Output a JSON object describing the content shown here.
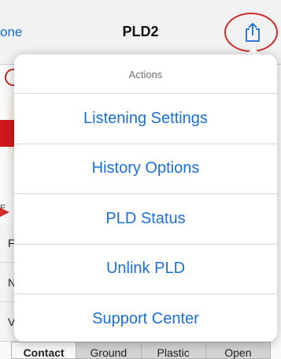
{
  "navbar": {
    "back_label": "one",
    "title": "PLD2",
    "share_icon": "share-icon"
  },
  "background": {
    "label_fragment": "E",
    "row_letters": [
      "F",
      "N",
      "V"
    ]
  },
  "segments": [
    "Contact",
    "Ground",
    "Plastic",
    "Open"
  ],
  "popover": {
    "title": "Actions",
    "items": [
      "Listening Settings",
      "History Options",
      "PLD Status",
      "Unlink PLD",
      "Support Center"
    ]
  },
  "colors": {
    "accent": "#1a6fd8",
    "highlight": "#d32f2f"
  }
}
